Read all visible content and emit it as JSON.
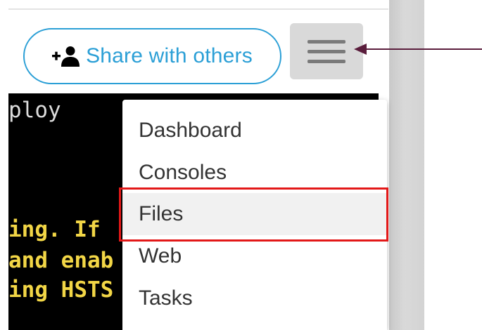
{
  "header": {
    "share_button_label": "Share with others",
    "share_icon": "add-person-icon",
    "menu_icon": "hamburger-menu-icon"
  },
  "terminal": {
    "lines": [
      {
        "text": "ploy",
        "color": "#dcdcdc"
      },
      {
        "text": "ing. If",
        "color": "#f2d646"
      },
      {
        "text": "and enab",
        "color": "#f2d646"
      },
      {
        "text": "ing HSTS",
        "color": "#f2d646"
      }
    ]
  },
  "dropdown": {
    "items": [
      {
        "label": "Dashboard"
      },
      {
        "label": "Consoles"
      },
      {
        "label": "Files",
        "highlighted": true
      },
      {
        "label": "Web"
      },
      {
        "label": "Tasks"
      }
    ]
  },
  "colors": {
    "accent": "#2b9fd6",
    "highlight_box": "#e31818",
    "arrow": "#5a1d3c",
    "terminal_bg": "#000000",
    "terminal_text_yellow": "#f2d646"
  }
}
